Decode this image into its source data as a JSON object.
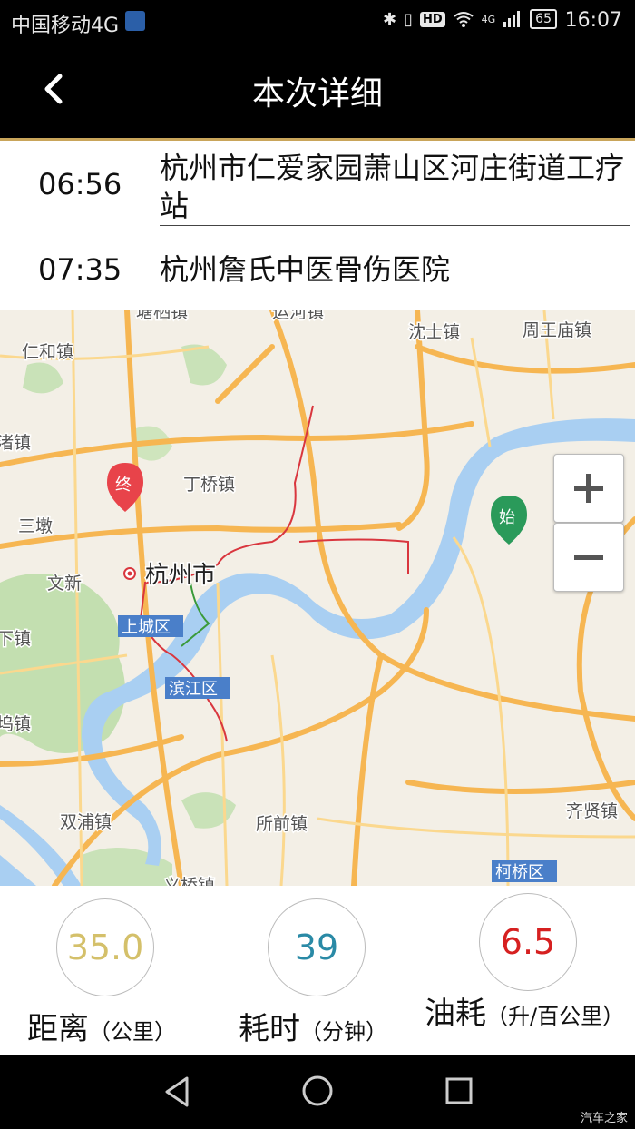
{
  "status_bar": {
    "carrier": "中国移动4G",
    "hd": "HD",
    "signal": "4G",
    "battery": "65",
    "time": "16:07"
  },
  "header": {
    "title": "本次详细"
  },
  "route": {
    "start": {
      "time": "06:56",
      "place": "杭州市仁爱家园萧山区河庄街道工疗站"
    },
    "end": {
      "time": "07:35",
      "place": "杭州詹氏中医骨伤医院"
    }
  },
  "map": {
    "labels": {
      "top_left": "仁和镇",
      "top_cut_a": "塘栖镇",
      "top_cut_b": "运河镇",
      "shen": "沈士镇",
      "zhouwang": "周王庙镇",
      "dingqiao": "丁桥镇",
      "zhu": "渚镇",
      "sandun": "三墩",
      "hangzhou": "杭州市",
      "wenxin": "文新",
      "shangcheng": "上城区",
      "xia": "下镇",
      "binjiang": "滨江区",
      "wu": "坞镇",
      "shuangpu": "双浦镇",
      "suoqian": "所前镇",
      "yiqiao": "义桥镇",
      "qixian": "齐贤镇",
      "keqiao": "柯桥区"
    },
    "marker_end": "终",
    "marker_start": "始",
    "zoom_in": "+",
    "zoom_out": "−"
  },
  "stats": {
    "distance": {
      "value": "35.0",
      "label": "距离",
      "unit": "（公里）",
      "color": "#d4c06a"
    },
    "duration": {
      "value": "39",
      "label": "耗时",
      "unit": "（分钟）",
      "color": "#2a8aa6"
    },
    "fuel": {
      "value": "6.5",
      "label": "油耗",
      "unit": "（升/百公里）",
      "color": "#d62020"
    }
  },
  "watermark": "汽车之家"
}
